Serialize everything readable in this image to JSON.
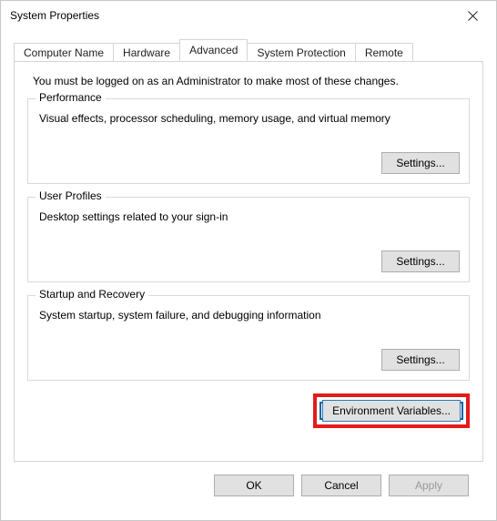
{
  "window": {
    "title": "System Properties"
  },
  "tabs": {
    "computer_name": "Computer Name",
    "hardware": "Hardware",
    "advanced": "Advanced",
    "system_protection": "System Protection",
    "remote": "Remote"
  },
  "panel": {
    "intro": "You must be logged on as an Administrator to make most of these changes.",
    "performance": {
      "title": "Performance",
      "desc": "Visual effects, processor scheduling, memory usage, and virtual memory",
      "button": "Settings..."
    },
    "user_profiles": {
      "title": "User Profiles",
      "desc": "Desktop settings related to your sign-in",
      "button": "Settings..."
    },
    "startup_recovery": {
      "title": "Startup and Recovery",
      "desc": "System startup, system failure, and debugging information",
      "button": "Settings..."
    },
    "env_button": "Environment Variables..."
  },
  "footer": {
    "ok": "OK",
    "cancel": "Cancel",
    "apply": "Apply"
  }
}
